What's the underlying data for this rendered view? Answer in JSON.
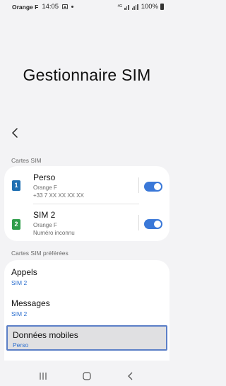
{
  "status_bar": {
    "carrier": "Orange F",
    "time": "14:05",
    "network": "4G",
    "battery": "100%"
  },
  "page": {
    "title": "Gestionnaire SIM"
  },
  "sim_cards": {
    "section_label": "Cartes SIM",
    "items": [
      {
        "slot": "1",
        "name": "Perso",
        "carrier": "Orange F",
        "number": "+33 7 XX XX XX XX",
        "enabled": true,
        "badge_color": "#1f6fb2"
      },
      {
        "slot": "2",
        "name": "SIM 2",
        "carrier": "Orange F",
        "number": "Numéro inconnu",
        "enabled": true,
        "badge_color": "#2e9d4a"
      }
    ]
  },
  "preferred": {
    "section_label": "Cartes SIM préférées",
    "items": [
      {
        "title": "Appels",
        "value": "SIM 2"
      },
      {
        "title": "Messages",
        "value": "SIM 2"
      },
      {
        "title": "Données mobiles",
        "value": "Perso",
        "selected": true
      }
    ]
  },
  "colors": {
    "accent": "#3a78d8",
    "link": "#2c6fcf",
    "background": "#f3f3f5"
  }
}
